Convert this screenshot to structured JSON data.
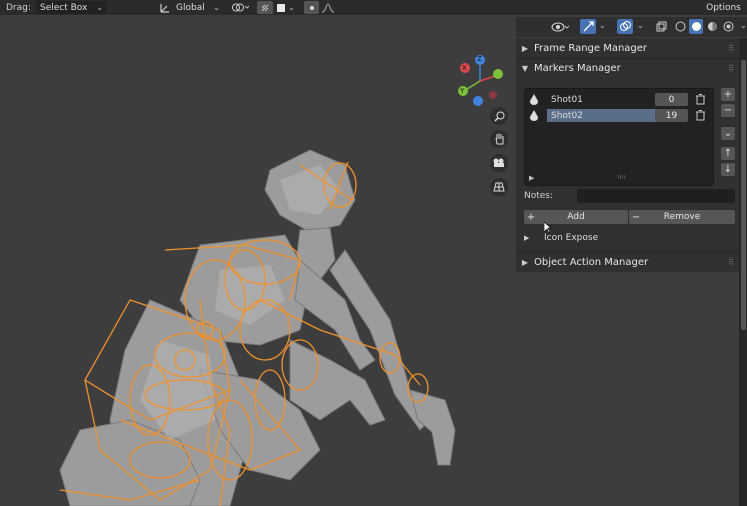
{
  "topbar": {
    "drag_label": "Drag:",
    "drag_value": "Select Box",
    "orientation_value": "Global",
    "options_label": "Options"
  },
  "panel": {
    "frame_range_title": "Frame Range Manager",
    "markers_title": "Markers Manager",
    "markers": [
      {
        "name": "Shot01",
        "frame": "0"
      },
      {
        "name": "Shot02",
        "frame": "19"
      }
    ],
    "notes_label": "Notes:",
    "add_label": "Add",
    "remove_label": "Remove",
    "icon_expose_label": "Icon Expose",
    "object_action_title": "Object Action Manager"
  },
  "gizmo": {
    "x": "X",
    "y": "Y",
    "z": "Z"
  },
  "colors": {
    "bone_orange": "#f0922b",
    "selected_row": "#5a6e8a",
    "axis_x": "#e0474f",
    "axis_y": "#7cc23a",
    "axis_z": "#3f84e0"
  }
}
